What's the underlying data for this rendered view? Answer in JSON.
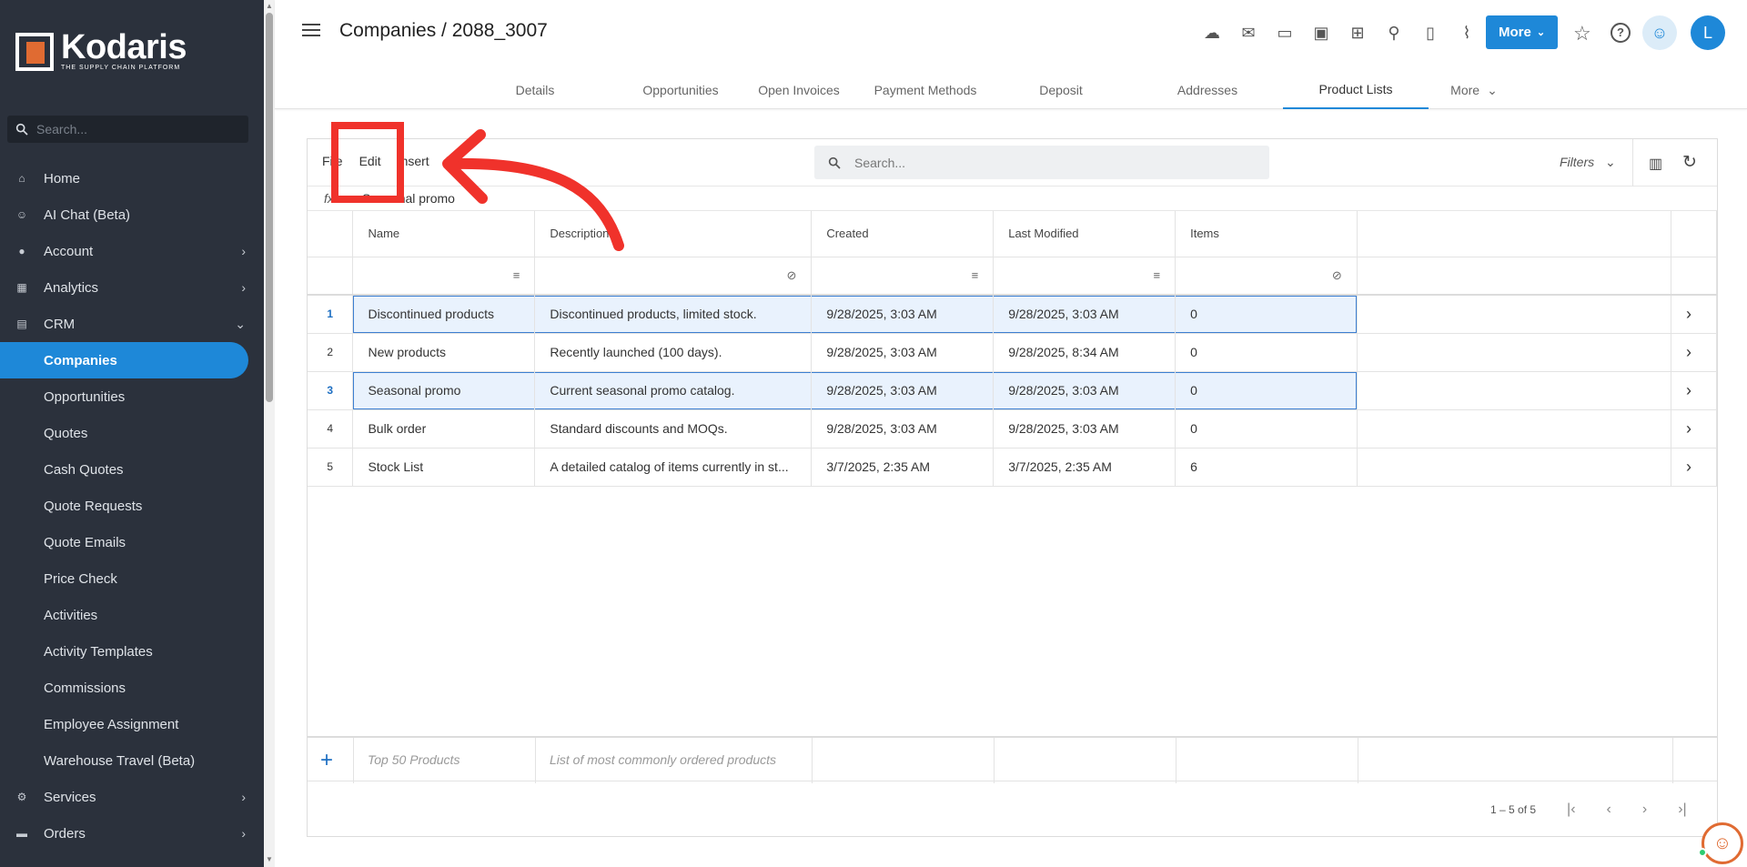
{
  "app": {
    "brand": "Kodaris",
    "tagline": "THE SUPPLY CHAIN PLATFORM",
    "page_title": "Companies / 2088_3007",
    "avatar_initial": "L",
    "accent_color": "#1e88d8",
    "sidebar_bg": "#2b313c"
  },
  "sidebar": {
    "search_placeholder": "Search...",
    "items": [
      {
        "label": "Home",
        "icon": "home-icon",
        "chevron": ""
      },
      {
        "label": "AI Chat (Beta)",
        "icon": "robot-icon",
        "chevron": ""
      },
      {
        "label": "Account",
        "icon": "person-icon",
        "chevron": "›"
      },
      {
        "label": "Analytics",
        "icon": "analytics-icon",
        "chevron": "›"
      },
      {
        "label": "CRM",
        "icon": "crm-icon",
        "chevron": "⌄"
      },
      {
        "label": "Companies",
        "icon": "",
        "chevron": ""
      },
      {
        "label": "Opportunities",
        "icon": "",
        "chevron": ""
      },
      {
        "label": "Quotes",
        "icon": "",
        "chevron": ""
      },
      {
        "label": "Cash Quotes",
        "icon": "",
        "chevron": ""
      },
      {
        "label": "Quote Requests",
        "icon": "",
        "chevron": ""
      },
      {
        "label": "Quote Emails",
        "icon": "",
        "chevron": ""
      },
      {
        "label": "Price Check",
        "icon": "",
        "chevron": ""
      },
      {
        "label": "Activities",
        "icon": "",
        "chevron": ""
      },
      {
        "label": "Activity Templates",
        "icon": "",
        "chevron": ""
      },
      {
        "label": "Commissions",
        "icon": "",
        "chevron": ""
      },
      {
        "label": "Employee Assignment",
        "icon": "",
        "chevron": ""
      },
      {
        "label": "Warehouse Travel (Beta)",
        "icon": "",
        "chevron": ""
      },
      {
        "label": "Services",
        "icon": "services-icon",
        "chevron": "›"
      },
      {
        "label": "Orders",
        "icon": "truck-icon",
        "chevron": "›"
      }
    ]
  },
  "header": {
    "more_label": "More",
    "icons": [
      "cloud-lock-icon",
      "mail-icon",
      "payment-icon",
      "gift-icon",
      "add-screen-icon",
      "add-person-icon",
      "add-file-icon",
      "attachment-icon"
    ]
  },
  "tabs": [
    "Details",
    "Opportunities",
    "Open Invoices",
    "Payment Methods",
    "Deposit",
    "Addresses",
    "Product Lists",
    "More"
  ],
  "toolbar": {
    "menu": [
      "File",
      "Edit",
      "Insert",
      "F"
    ],
    "search_placeholder": "Search...",
    "filters_label": "Filters"
  },
  "formula_bar": {
    "label": "fx",
    "value": "Seasonal promo"
  },
  "table": {
    "columns": [
      "Name",
      "Description",
      "Created",
      "Last Modified",
      "Items"
    ],
    "rows": [
      {
        "num": "1",
        "name": "Discontinued products",
        "description": "Discontinued products, limited stock.",
        "created": "9/28/2025, 3:03 AM",
        "modified": "9/28/2025, 3:03 AM",
        "items": "0",
        "selected": true
      },
      {
        "num": "2",
        "name": "New products",
        "description": "Recently launched (100 days).",
        "created": "9/28/2025, 3:03 AM",
        "modified": "9/28/2025, 8:34 AM",
        "items": "0",
        "selected": false
      },
      {
        "num": "3",
        "name": "Seasonal promo",
        "description": "Current seasonal promo catalog.",
        "created": "9/28/2025, 3:03 AM",
        "modified": "9/28/2025, 3:03 AM",
        "items": "0",
        "selected": true
      },
      {
        "num": "4",
        "name": "Bulk order",
        "description": "Standard discounts and MOQs.",
        "created": "9/28/2025, 3:03 AM",
        "modified": "9/28/2025, 3:03 AM",
        "items": "0",
        "selected": false
      },
      {
        "num": "5",
        "name": "Stock List",
        "description": "A detailed catalog of items currently in st...",
        "created": "3/7/2025, 2:35 AM",
        "modified": "3/7/2025, 2:35 AM",
        "items": "6",
        "selected": false
      }
    ],
    "new_row": {
      "name_placeholder": "Top 50 Products",
      "description_placeholder": "List of most commonly ordered products"
    }
  },
  "pager": {
    "range": "1 – 5 of 5"
  },
  "annotation": {
    "color": "#f0322b"
  }
}
